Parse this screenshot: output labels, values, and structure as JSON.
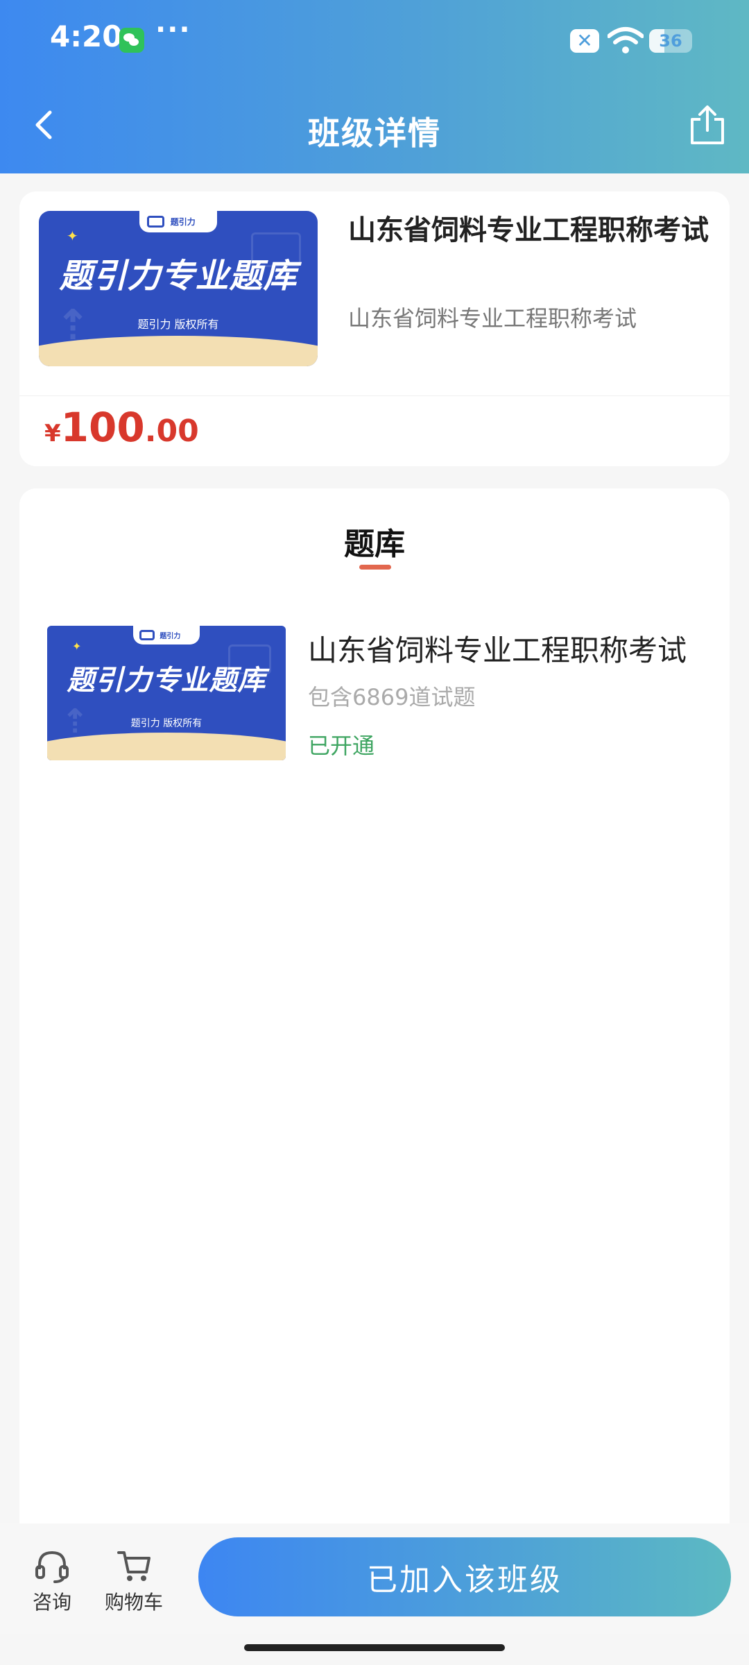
{
  "status_bar": {
    "time": "4:20",
    "more": "···",
    "notification_glyph": "✕",
    "battery_level": "36",
    "battery_fraction": 0.36,
    "icons": [
      "wechat-icon",
      "notification-icon",
      "wifi-icon",
      "battery-icon"
    ]
  },
  "nav": {
    "title": "班级详情",
    "back_icon": "back-chevron-icon",
    "share_icon": "share-icon"
  },
  "course": {
    "title": "山东省饲料专业工程职称考试",
    "subtitle": "山东省饲料专业工程职称考试",
    "price_symbol": "¥",
    "price_integer": "100",
    "price_decimal": ".00",
    "cover": {
      "logo_text": "题引力",
      "headline": "题引力专业题库",
      "copyright": "题引力 版权所有"
    }
  },
  "question_bank": {
    "tab_label": "题库",
    "items": [
      {
        "title": "山东省饲料专业工程职称考试",
        "count_text": "包含6869道试题",
        "status": "已开通"
      }
    ]
  },
  "bottom_bar": {
    "consult_label": "咨询",
    "cart_label": "购物车",
    "join_label": "已加入该班级"
  },
  "colors": {
    "header_gradient_start": "#3d89f0",
    "header_gradient_end": "#5fb8c4",
    "price": "#d8382c",
    "status_active": "#3ea561",
    "tab_indicator": "#e2674e",
    "cover_blue": "#2f4fbf"
  }
}
